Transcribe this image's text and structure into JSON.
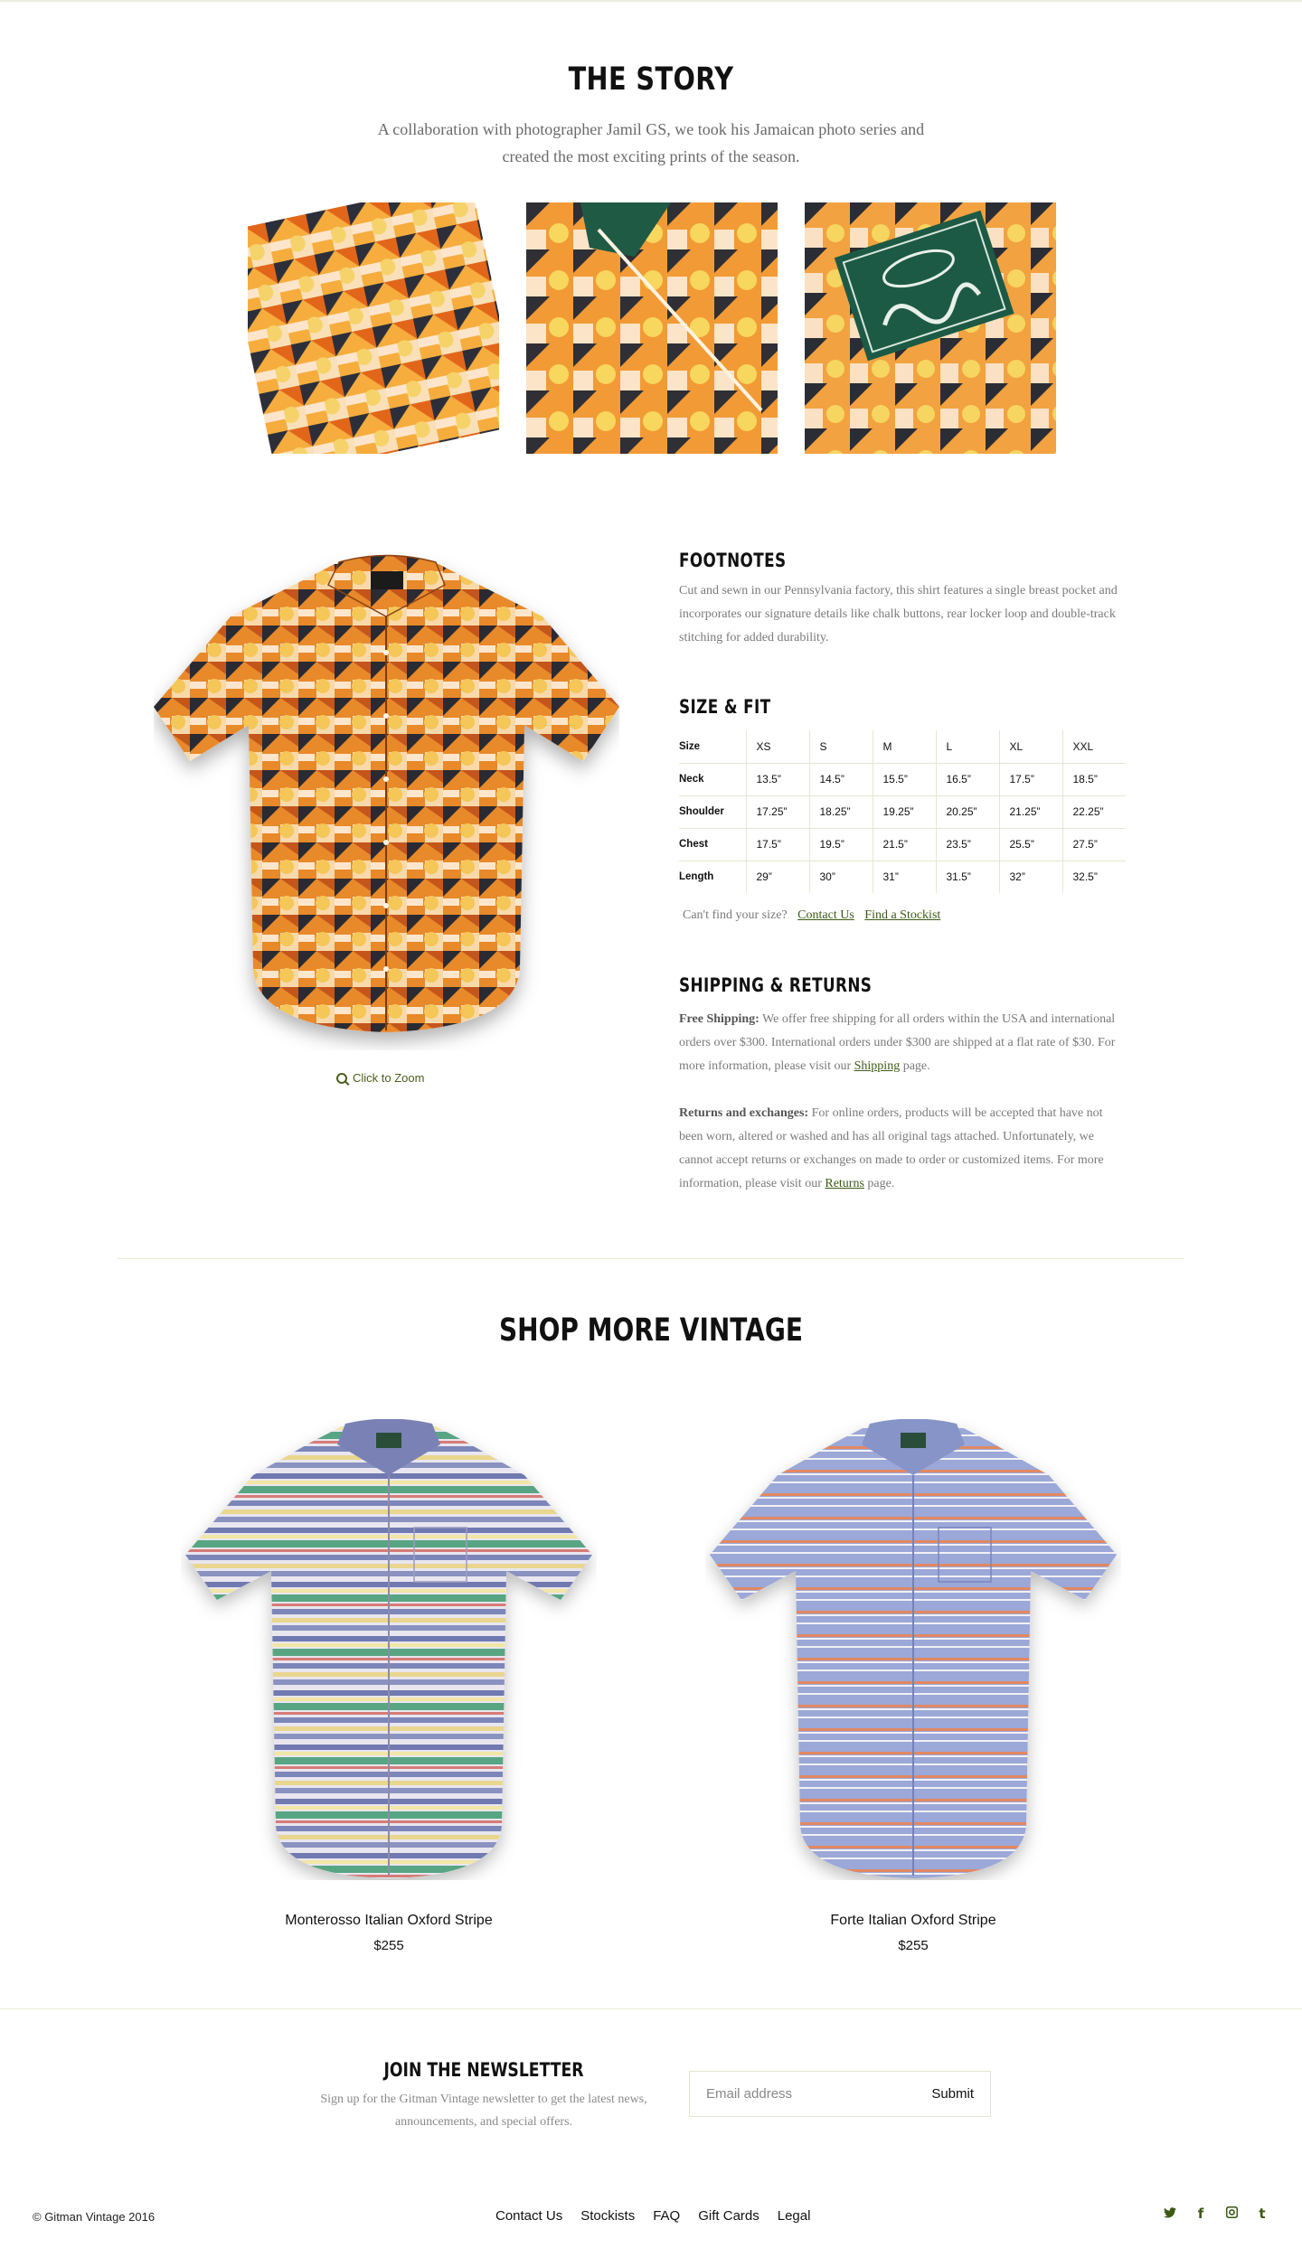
{
  "story": {
    "title": "THE STORY",
    "subtitle": "A collaboration with photographer Jamil GS, we took his Jamaican photo series and created the most exciting prints of the season."
  },
  "product": {
    "zoom_label": "Click to Zoom",
    "footnotes_title": "FOOTNOTES",
    "footnotes_text": "Cut and sewn in our Pennsylvania factory, this shirt features a single breast pocket and incorporates our signature details like chalk buttons, rear locker loop and double-track stitching for added durability.",
    "size_title": "SIZE & FIT",
    "size_table": {
      "header": [
        "Size",
        "XS",
        "S",
        "M",
        "L",
        "XL",
        "XXL"
      ],
      "rows": [
        [
          "Neck",
          "13.5”",
          "14.5”",
          "15.5”",
          "16.5”",
          "17.5”",
          "18.5”"
        ],
        [
          "Shoulder",
          "17.25”",
          "18.25”",
          "19.25”",
          "20.25”",
          "21.25”",
          "22.25”"
        ],
        [
          "Chest",
          "17.5”",
          "19.5”",
          "21.5”",
          "23.5”",
          "25.5”",
          "27.5”"
        ],
        [
          "Length",
          "29”",
          "30”",
          "31”",
          "31.5”",
          "32”",
          "32.5”"
        ]
      ]
    },
    "size_help": "Can't find your size?",
    "contact_link": "Contact Us",
    "stockist_link": "Find a Stockist",
    "shipping_title": "SHIPPING & RETURNS",
    "shipping_label": "Free Shipping:",
    "shipping_text": " We offer free shipping for all orders within the USA and international orders over $300. International orders under $300 are shipped at a flat rate of $30. For more information, please visit our ",
    "shipping_link": "Shipping",
    "shipping_end": " page.",
    "returns_label": "Returns and exchanges:",
    "returns_text": " For online orders, products will be accepted that have not been worn, altered or washed and has all original tags attached. Unfortunately, we cannot accept returns or exchanges on made to order or customized items. For more information, please visit our ",
    "returns_link": "Returns",
    "returns_end": " page."
  },
  "shop_more": {
    "title": "SHOP MORE VINTAGE",
    "items": [
      {
        "name": "Monterosso Italian Oxford Stripe",
        "price": "$255"
      },
      {
        "name": "Forte Italian Oxford Stripe",
        "price": "$255"
      }
    ]
  },
  "newsletter": {
    "title": "JOIN THE NEWSLETTER",
    "subtitle": "Sign up for the Gitman Vintage newsletter to get the latest news, announcements, and special offers.",
    "placeholder": "Email address",
    "submit": "Submit"
  },
  "footer": {
    "copyright": "© Gitman Vintage 2016",
    "links": [
      "Contact Us",
      "Stockists",
      "FAQ",
      "Gift Cards",
      "Legal"
    ],
    "social_icons": [
      "twitter-icon",
      "facebook-icon",
      "instagram-icon",
      "tumblr-icon"
    ],
    "social_glyphs": [
      "🐦",
      "f",
      "◙",
      "t"
    ]
  },
  "colors": {
    "accent": "#3b5a14",
    "print_orange": "#e8892b",
    "divider": "#e6e9d5"
  }
}
